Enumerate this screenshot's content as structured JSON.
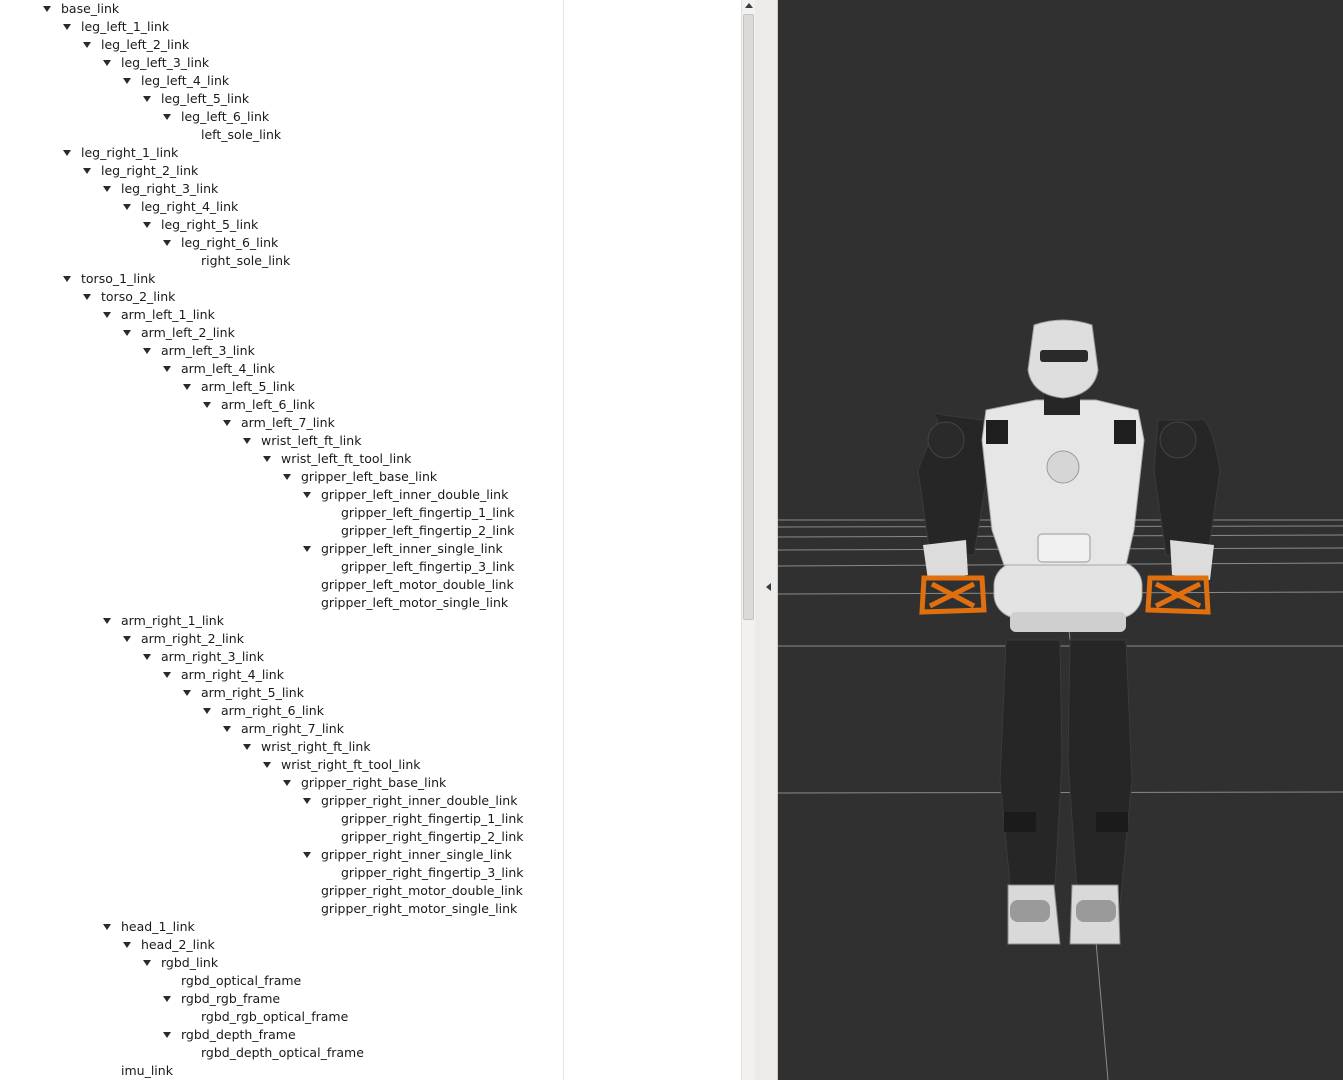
{
  "tree": {
    "rows": [
      {
        "label": "base_link",
        "depth": 0,
        "expanded": true
      },
      {
        "label": "leg_left_1_link",
        "depth": 1,
        "expanded": true
      },
      {
        "label": "leg_left_2_link",
        "depth": 2,
        "expanded": true
      },
      {
        "label": "leg_left_3_link",
        "depth": 3,
        "expanded": true
      },
      {
        "label": "leg_left_4_link",
        "depth": 4,
        "expanded": true
      },
      {
        "label": "leg_left_5_link",
        "depth": 5,
        "expanded": true
      },
      {
        "label": "leg_left_6_link",
        "depth": 6,
        "expanded": true
      },
      {
        "label": "left_sole_link",
        "depth": 7,
        "expanded": false
      },
      {
        "label": "leg_right_1_link",
        "depth": 1,
        "expanded": true
      },
      {
        "label": "leg_right_2_link",
        "depth": 2,
        "expanded": true
      },
      {
        "label": "leg_right_3_link",
        "depth": 3,
        "expanded": true
      },
      {
        "label": "leg_right_4_link",
        "depth": 4,
        "expanded": true
      },
      {
        "label": "leg_right_5_link",
        "depth": 5,
        "expanded": true
      },
      {
        "label": "leg_right_6_link",
        "depth": 6,
        "expanded": true
      },
      {
        "label": "right_sole_link",
        "depth": 7,
        "expanded": false
      },
      {
        "label": "torso_1_link",
        "depth": 1,
        "expanded": true
      },
      {
        "label": "torso_2_link",
        "depth": 2,
        "expanded": true
      },
      {
        "label": "arm_left_1_link",
        "depth": 3,
        "expanded": true
      },
      {
        "label": "arm_left_2_link",
        "depth": 4,
        "expanded": true
      },
      {
        "label": "arm_left_3_link",
        "depth": 5,
        "expanded": true
      },
      {
        "label": "arm_left_4_link",
        "depth": 6,
        "expanded": true
      },
      {
        "label": "arm_left_5_link",
        "depth": 7,
        "expanded": true
      },
      {
        "label": "arm_left_6_link",
        "depth": 8,
        "expanded": true
      },
      {
        "label": "arm_left_7_link",
        "depth": 9,
        "expanded": true
      },
      {
        "label": "wrist_left_ft_link",
        "depth": 10,
        "expanded": true
      },
      {
        "label": "wrist_left_ft_tool_link",
        "depth": 11,
        "expanded": true
      },
      {
        "label": "gripper_left_base_link",
        "depth": 12,
        "expanded": true
      },
      {
        "label": "gripper_left_inner_double_link",
        "depth": 13,
        "expanded": true
      },
      {
        "label": "gripper_left_fingertip_1_link",
        "depth": 14,
        "expanded": false
      },
      {
        "label": "gripper_left_fingertip_2_link",
        "depth": 14,
        "expanded": false
      },
      {
        "label": "gripper_left_inner_single_link",
        "depth": 13,
        "expanded": true
      },
      {
        "label": "gripper_left_fingertip_3_link",
        "depth": 14,
        "expanded": false
      },
      {
        "label": "gripper_left_motor_double_link",
        "depth": 13,
        "expanded": false
      },
      {
        "label": "gripper_left_motor_single_link",
        "depth": 13,
        "expanded": false
      },
      {
        "label": "arm_right_1_link",
        "depth": 3,
        "expanded": true
      },
      {
        "label": "arm_right_2_link",
        "depth": 4,
        "expanded": true
      },
      {
        "label": "arm_right_3_link",
        "depth": 5,
        "expanded": true
      },
      {
        "label": "arm_right_4_link",
        "depth": 6,
        "expanded": true
      },
      {
        "label": "arm_right_5_link",
        "depth": 7,
        "expanded": true
      },
      {
        "label": "arm_right_6_link",
        "depth": 8,
        "expanded": true
      },
      {
        "label": "arm_right_7_link",
        "depth": 9,
        "expanded": true
      },
      {
        "label": "wrist_right_ft_link",
        "depth": 10,
        "expanded": true
      },
      {
        "label": "wrist_right_ft_tool_link",
        "depth": 11,
        "expanded": true
      },
      {
        "label": "gripper_right_base_link",
        "depth": 12,
        "expanded": true
      },
      {
        "label": "gripper_right_inner_double_link",
        "depth": 13,
        "expanded": true
      },
      {
        "label": "gripper_right_fingertip_1_link",
        "depth": 14,
        "expanded": false
      },
      {
        "label": "gripper_right_fingertip_2_link",
        "depth": 14,
        "expanded": false
      },
      {
        "label": "gripper_right_inner_single_link",
        "depth": 13,
        "expanded": true
      },
      {
        "label": "gripper_right_fingertip_3_link",
        "depth": 14,
        "expanded": false
      },
      {
        "label": "gripper_right_motor_double_link",
        "depth": 13,
        "expanded": false
      },
      {
        "label": "gripper_right_motor_single_link",
        "depth": 13,
        "expanded": false
      },
      {
        "label": "head_1_link",
        "depth": 3,
        "expanded": true
      },
      {
        "label": "head_2_link",
        "depth": 4,
        "expanded": true
      },
      {
        "label": "rgbd_link",
        "depth": 5,
        "expanded": true
      },
      {
        "label": "rgbd_optical_frame",
        "depth": 6,
        "expanded": false
      },
      {
        "label": "rgbd_rgb_frame",
        "depth": 6,
        "expanded": true
      },
      {
        "label": "rgbd_rgb_optical_frame",
        "depth": 7,
        "expanded": false
      },
      {
        "label": "rgbd_depth_frame",
        "depth": 6,
        "expanded": true
      },
      {
        "label": "rgbd_depth_optical_frame",
        "depth": 7,
        "expanded": false
      },
      {
        "label": "imu_link",
        "depth": 3,
        "expanded": false
      }
    ]
  },
  "icons": {
    "expand_arrow": "triangle-down-icon",
    "scroll_up": "triangle-up-icon",
    "collapse_panel": "triangle-left-icon"
  },
  "colors": {
    "viewport_background": "#303030",
    "grid_line": "#8a8a8a",
    "robot_white": "#e8e8e8",
    "robot_dark": "#262626",
    "gripper_orange": "#e0700f"
  }
}
